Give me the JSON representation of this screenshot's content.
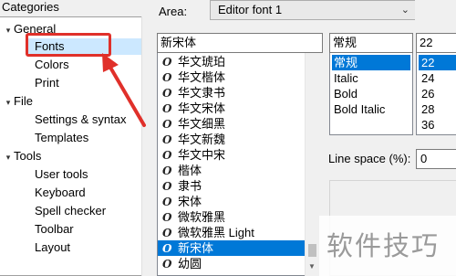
{
  "categories_label": "Categories",
  "tree": [
    {
      "label": "General",
      "expanded": true,
      "level": 0
    },
    {
      "label": "Fonts",
      "level": 1,
      "selected": true
    },
    {
      "label": "Colors",
      "level": 1
    },
    {
      "label": "Print",
      "level": 1
    },
    {
      "label": "File",
      "expanded": true,
      "level": 0
    },
    {
      "label": "Settings & syntax",
      "level": 1
    },
    {
      "label": "Templates",
      "level": 1
    },
    {
      "label": "Tools",
      "expanded": true,
      "level": 0
    },
    {
      "label": "User tools",
      "level": 1
    },
    {
      "label": "Keyboard",
      "level": 1
    },
    {
      "label": "Spell checker",
      "level": 1
    },
    {
      "label": "Toolbar",
      "level": 1
    },
    {
      "label": "Layout",
      "level": 1
    }
  ],
  "area": {
    "label": "Area:",
    "value": "Editor font 1"
  },
  "font": {
    "input_value": "新宋体",
    "items": [
      "华文琥珀",
      "华文楷体",
      "华文隶书",
      "华文宋体",
      "华文细黑",
      "华文新魏",
      "华文中宋",
      "楷体",
      "隶书",
      "宋体",
      "微软雅黑",
      "微软雅黑 Light",
      "新宋体",
      "幼圆"
    ],
    "selected": "新宋体"
  },
  "style": {
    "input_value": "常规",
    "items": [
      "常规",
      "Italic",
      "Bold",
      "Bold Italic"
    ],
    "selected": "常规"
  },
  "size": {
    "input_value": "22",
    "items": [
      "22",
      "24",
      "26",
      "28",
      "36"
    ],
    "selected": "22"
  },
  "line_space": {
    "label": "Line space (%):",
    "value": "0"
  },
  "watermark": "软件技巧",
  "colors": {
    "selection": "#0078d7",
    "tree_selection": "#cce8ff",
    "annotation": "#e0302a"
  }
}
